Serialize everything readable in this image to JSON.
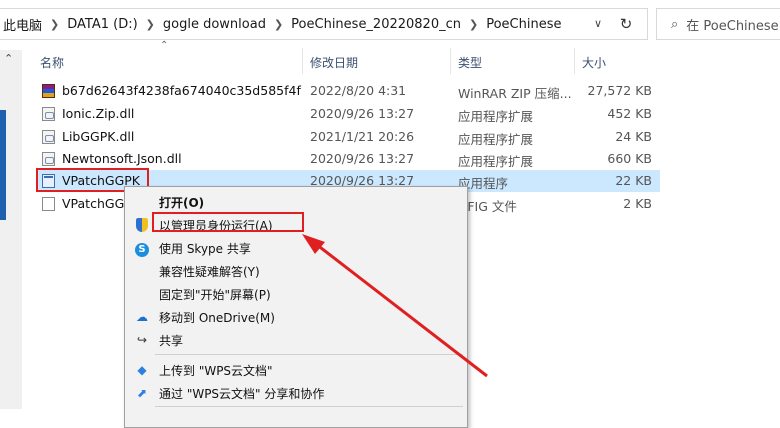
{
  "breadcrumb": [
    "此电脑",
    "DATA1 (D:)",
    "gogle download",
    "PoeChinese_20220820_cn",
    "PoeChinese"
  ],
  "search": {
    "placeholder": "在 PoeChinese 中搜索"
  },
  "icons": {
    "refresh": "refresh-icon",
    "dropdown": "chevron-down-icon",
    "search": "search-icon"
  },
  "columns": {
    "name": "名称",
    "date": "修改日期",
    "type": "类型",
    "size": "大小"
  },
  "files": [
    {
      "name": "b67d62643f4238fa674040c35d585f4f",
      "date": "2022/8/20 4:31",
      "type": "WinRAR ZIP 压缩...",
      "size": "27,572 KB",
      "icon": "rar"
    },
    {
      "name": "Ionic.Zip.dll",
      "date": "2020/9/26 13:27",
      "type": "应用程序扩展",
      "size": "452 KB",
      "icon": "dll"
    },
    {
      "name": "LibGGPK.dll",
      "date": "2021/1/21 20:26",
      "type": "应用程序扩展",
      "size": "24 KB",
      "icon": "dll"
    },
    {
      "name": "Newtonsoft.Json.dll",
      "date": "2020/9/26 13:27",
      "type": "应用程序扩展",
      "size": "660 KB",
      "icon": "dll"
    },
    {
      "name": "VPatchGGPK",
      "date": "2020/9/26 13:27",
      "type": "应用程序",
      "size": "22 KB",
      "icon": "exe"
    },
    {
      "name": "VPatchGG",
      "date": "",
      "type": "NFIG 文件",
      "size": "2 KB",
      "icon": "cfg"
    }
  ],
  "context_menu": {
    "open": "打开(O)",
    "run_as_admin": "以管理员身份运行(A)",
    "skype_share": "使用 Skype 共享",
    "compat": "兼容性疑难解答(Y)",
    "pin_start": "固定到\"开始\"屏幕(P)",
    "onedrive": "移动到 OneDrive(M)",
    "share": "共享",
    "wps_upload": "上传到 \"WPS云文档\"",
    "wps_share": "通过 \"WPS云文档\" 分享和协作"
  },
  "colors": {
    "selected_row": "#cce8ff",
    "highlight": "#e02020",
    "scroll_accent": "#1f5fb0"
  }
}
